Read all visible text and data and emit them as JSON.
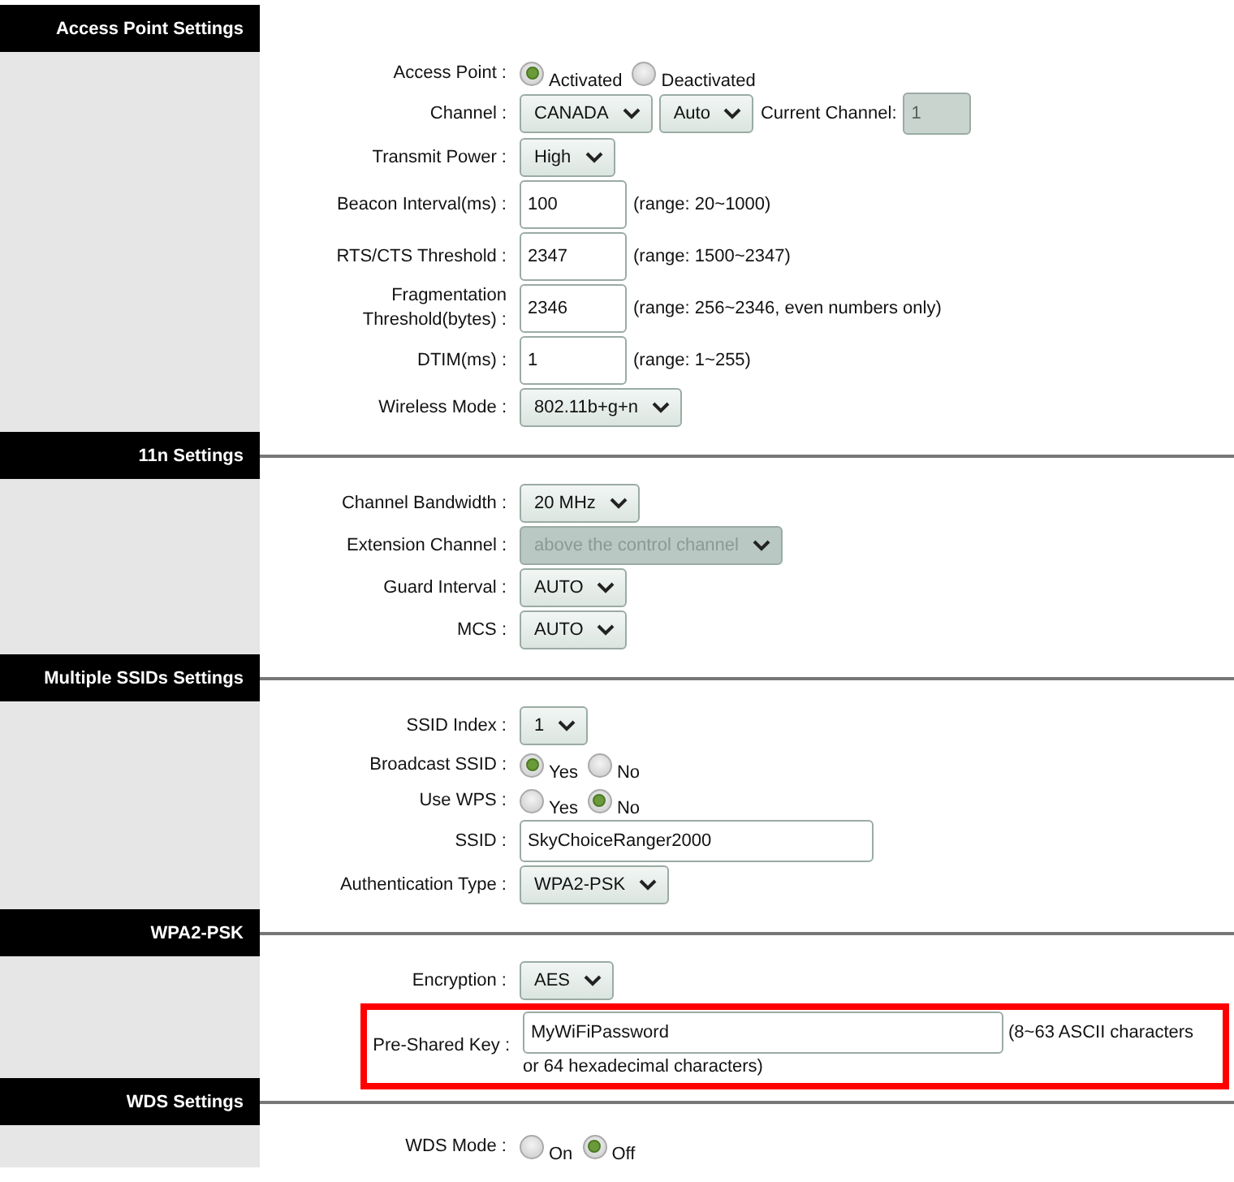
{
  "sections": [
    {
      "title": "Access Point Settings",
      "rows": [
        {
          "label": "Access Point :",
          "controls": [
            {
              "kind": "radio",
              "label": "Activated",
              "selected": true
            },
            {
              "kind": "radio",
              "label": "Deactivated",
              "selected": false
            }
          ]
        },
        {
          "label": "Channel :",
          "controls": [
            {
              "kind": "select",
              "value": "CANADA",
              "disabled": false
            },
            {
              "kind": "select",
              "value": "Auto",
              "disabled": false
            },
            {
              "kind": "note",
              "text": "Current Channel:"
            },
            {
              "kind": "text",
              "value": "1",
              "disabled": true
            }
          ]
        },
        {
          "label": "Transmit Power :",
          "controls": [
            {
              "kind": "select",
              "value": "High",
              "disabled": false
            }
          ]
        },
        {
          "label": "Beacon Interval(ms) :",
          "controls": [
            {
              "kind": "text",
              "value": "100",
              "disabled": false
            },
            {
              "kind": "note",
              "text": "(range: 20~1000)"
            }
          ]
        },
        {
          "label": "RTS/CTS Threshold :",
          "controls": [
            {
              "kind": "text",
              "value": "2347",
              "disabled": false
            },
            {
              "kind": "note",
              "text": "(range: 1500~2347)"
            }
          ]
        },
        {
          "label": "Fragmentation Threshold(bytes) :",
          "controls": [
            {
              "kind": "text",
              "value": "2346",
              "disabled": false
            },
            {
              "kind": "note",
              "text": "(range: 256~2346, even numbers only)"
            }
          ]
        },
        {
          "label": "DTIM(ms) :",
          "controls": [
            {
              "kind": "text",
              "value": "1",
              "disabled": false
            },
            {
              "kind": "note",
              "text": "(range: 1~255)"
            }
          ]
        },
        {
          "label": "Wireless Mode :",
          "controls": [
            {
              "kind": "select",
              "value": "802.11b+g+n",
              "disabled": false
            }
          ]
        }
      ]
    },
    {
      "title": "11n Settings",
      "rows": [
        {
          "label": "Channel Bandwidth :",
          "controls": [
            {
              "kind": "select",
              "value": "20 MHz",
              "disabled": false
            }
          ]
        },
        {
          "label": "Extension Channel :",
          "controls": [
            {
              "kind": "select",
              "value": "above the control channel",
              "disabled": true
            }
          ]
        },
        {
          "label": "Guard Interval :",
          "controls": [
            {
              "kind": "select",
              "value": "AUTO",
              "disabled": false
            }
          ]
        },
        {
          "label": "MCS :",
          "controls": [
            {
              "kind": "select",
              "value": "AUTO",
              "disabled": false
            }
          ]
        }
      ]
    },
    {
      "title": "Multiple SSIDs Settings",
      "rows": [
        {
          "label": "SSID Index :",
          "controls": [
            {
              "kind": "select",
              "value": "1",
              "disabled": false
            }
          ]
        },
        {
          "label": "Broadcast SSID :",
          "controls": [
            {
              "kind": "radio",
              "label": "Yes",
              "selected": true
            },
            {
              "kind": "radio",
              "label": "No",
              "selected": false
            }
          ]
        },
        {
          "label": "Use WPS :",
          "controls": [
            {
              "kind": "radio",
              "label": "Yes",
              "selected": false
            },
            {
              "kind": "radio",
              "label": "No",
              "selected": true
            }
          ]
        },
        {
          "label": "SSID :",
          "controls": [
            {
              "kind": "wide-text",
              "value": "SkyChoiceRanger2000",
              "disabled": false
            }
          ]
        },
        {
          "label": "Authentication Type :",
          "controls": [
            {
              "kind": "select",
              "value": "WPA2-PSK",
              "disabled": false
            }
          ]
        }
      ]
    },
    {
      "title": "WPA2-PSK",
      "rows": [
        {
          "label": "Encryption :",
          "controls": [
            {
              "kind": "select",
              "value": "AES",
              "disabled": false
            }
          ]
        },
        {
          "label": "Pre-Shared Key :",
          "highlighted": true,
          "controls": [
            {
              "kind": "key-text",
              "value": "MyWiFiPassword",
              "disabled": false
            },
            {
              "kind": "note",
              "text": "(8~63 ASCII characters"
            },
            {
              "kind": "wrapped-note",
              "text": "or 64 hexadecimal characters)"
            }
          ]
        }
      ]
    },
    {
      "title": "WDS Settings",
      "rows": [
        {
          "label": "WDS Mode :",
          "controls": [
            {
              "kind": "radio",
              "label": "On",
              "selected": false
            },
            {
              "kind": "radio",
              "label": "Off",
              "selected": true
            }
          ]
        }
      ]
    }
  ]
}
